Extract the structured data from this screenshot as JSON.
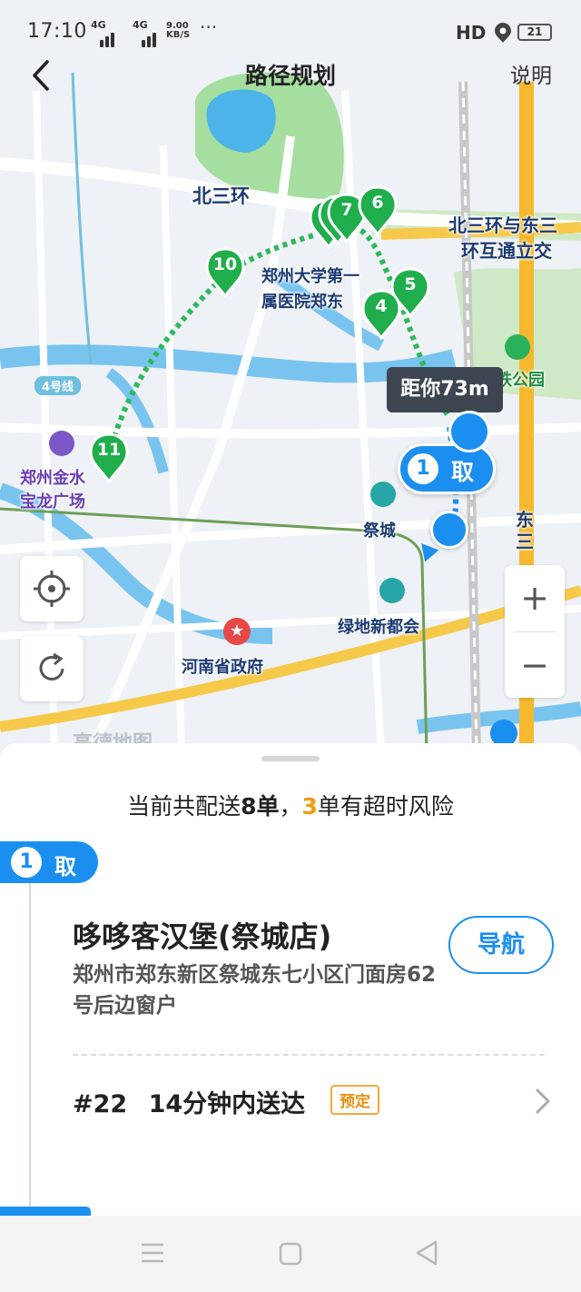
{
  "status_bar": {
    "time": "17:10",
    "sig1": "4G",
    "sig2": "4G",
    "speed_value": "9.00",
    "speed_unit": "KB/S",
    "more": "···",
    "hd": "HD",
    "battery": "21"
  },
  "header": {
    "title": "路径规划",
    "help": "说明"
  },
  "map": {
    "road_north": "北三环",
    "road_junction_1": "北三环与东三",
    "road_junction_2": "环互通立交",
    "hospital_1": "郑州大学第一",
    "hospital_2": "属医院郑东",
    "metro_line": "4号线",
    "mall_1": "郑州金水",
    "mall_2": "宝龙广场",
    "park": "高铁公园",
    "station": "祭城",
    "greenland": "绿地新都会",
    "government": "河南省政府",
    "road_east": "东三",
    "watermark": "高德地图",
    "distance": "距你73m",
    "pickup_num": "1",
    "pickup_label": "取",
    "pins": [
      "11",
      "10",
      "7",
      "6",
      "5",
      "4"
    ],
    "zoom_in": "+",
    "zoom_out": "−"
  },
  "colors": {
    "accent": "#1b8ff0",
    "pin_green": "#1fae4b",
    "risk": "#f39c12"
  },
  "summary": {
    "prefix": "当前共配送",
    "count": "8单",
    "sep": "，",
    "risk_count": "3",
    "suffix": "单有超时风险"
  },
  "task": {
    "badge_num": "1",
    "badge_label": "取",
    "shop_name": "哆哆客汉堡(祭城店)",
    "address": "郑州市郑东新区祭城东七小区门面房62号后边窗户",
    "nav_label": "导航",
    "order_no": "#22",
    "deadline": "14分钟内送达",
    "tag": "预定"
  }
}
